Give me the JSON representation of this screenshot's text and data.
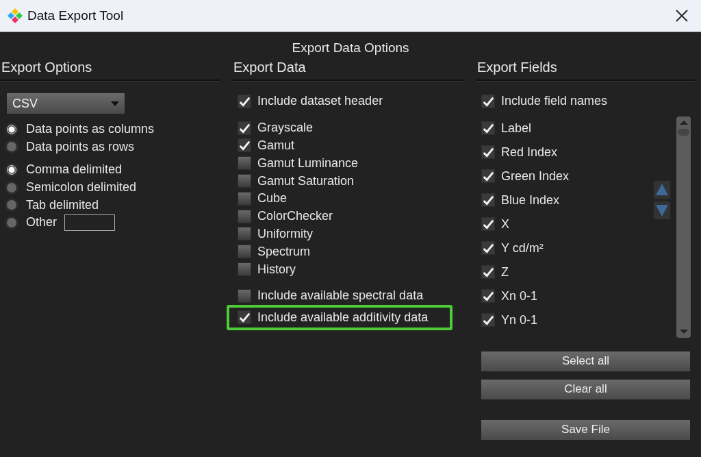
{
  "window": {
    "title": "Data Export Tool"
  },
  "heading": "Export Data Options",
  "export_options": {
    "title": "Export Options",
    "format": {
      "value": "CSV"
    },
    "layout": [
      {
        "label": "Data points as columns",
        "selected": true
      },
      {
        "label": "Data points as rows",
        "selected": false
      }
    ],
    "delimiters": [
      {
        "label": "Comma delimited",
        "selected": true,
        "kind": "radio"
      },
      {
        "label": "Semicolon delimited",
        "selected": false,
        "kind": "radio"
      },
      {
        "label": "Tab delimited",
        "selected": false,
        "kind": "radio"
      },
      {
        "label": "Other",
        "selected": false,
        "kind": "radio-with-field"
      }
    ]
  },
  "export_data": {
    "title": "Export Data",
    "header_option": {
      "label": "Include dataset header",
      "checked": true
    },
    "datasets": [
      {
        "label": "Grayscale",
        "checked": true
      },
      {
        "label": "Gamut",
        "checked": true
      },
      {
        "label": "Gamut Luminance",
        "checked": false
      },
      {
        "label": "Gamut Saturation",
        "checked": false
      },
      {
        "label": "Cube",
        "checked": false
      },
      {
        "label": "ColorChecker",
        "checked": false
      },
      {
        "label": "Uniformity",
        "checked": false
      },
      {
        "label": "Spectrum",
        "checked": false
      },
      {
        "label": "History",
        "checked": false
      }
    ],
    "extras": [
      {
        "label": "Include available spectral data",
        "checked": false,
        "highlighted": false
      },
      {
        "label": "Include available additivity data",
        "checked": true,
        "highlighted": true
      }
    ]
  },
  "export_fields": {
    "title": "Export Fields",
    "field_names_option": {
      "label": "Include field names",
      "checked": true
    },
    "fields": [
      {
        "label": "Label",
        "checked": true
      },
      {
        "label": "Red Index",
        "checked": true
      },
      {
        "label": "Green Index",
        "checked": true
      },
      {
        "label": "Blue Index",
        "checked": true
      },
      {
        "label": "X",
        "checked": true
      },
      {
        "label": "Y cd/m²",
        "checked": true
      },
      {
        "label": "Z",
        "checked": true
      },
      {
        "label": "Xn 0-1",
        "checked": true
      },
      {
        "label": "Yn 0-1",
        "checked": true
      }
    ],
    "buttons": [
      "Select all",
      "Clear all",
      "Save File"
    ]
  }
}
